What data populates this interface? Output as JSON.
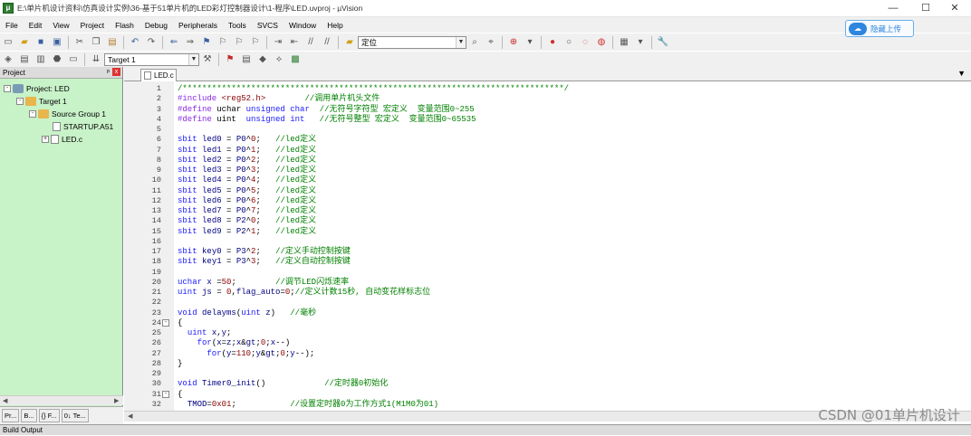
{
  "window": {
    "title": "E:\\单片机设计资料\\仿真设计实例\\36-基于51单片机的LED彩灯控制器设计\\1-程序\\LED.uvproj - µVision",
    "minimize": "—",
    "maximize": "☐",
    "close": "✕"
  },
  "menu": [
    "File",
    "Edit",
    "View",
    "Project",
    "Flash",
    "Debug",
    "Peripherals",
    "Tools",
    "SVCS",
    "Window",
    "Help"
  ],
  "toolbar1": {
    "find_value": "定位"
  },
  "toolbar2": {
    "target": "Target 1"
  },
  "upload_button": "隐藏上传",
  "project_panel": {
    "header": "Project",
    "pin": "ᵖ",
    "close": "x",
    "tree": [
      {
        "label": "Project: LED",
        "exp": "-"
      },
      {
        "label": "Target 1",
        "exp": "-"
      },
      {
        "label": "Source Group 1",
        "exp": "-"
      },
      {
        "label": "STARTUP.A51",
        "exp": ""
      },
      {
        "label": "LED.c",
        "exp": "+"
      }
    ],
    "tabs": [
      "Pr...",
      "B...",
      "{} F...",
      "0↓ Te..."
    ]
  },
  "editor": {
    "tab": "LED.c",
    "lines": [
      {
        "n": "1",
        "f": "",
        "t": "/******************************************************************************/"
      },
      {
        "n": "2",
        "f": "",
        "t": "#include <reg52.h>        //调用单片机头文件"
      },
      {
        "n": "3",
        "f": "",
        "t": "#define uchar unsigned char  //无符号字符型 宏定义  变量范围0~255"
      },
      {
        "n": "4",
        "f": "",
        "t": "#define uint  unsigned int   //无符号整型 宏定义  变量范围0~65535"
      },
      {
        "n": "5",
        "f": "",
        "t": ""
      },
      {
        "n": "6",
        "f": "",
        "t": "sbit led0 = P0^0;   //led定义"
      },
      {
        "n": "7",
        "f": "",
        "t": "sbit led1 = P0^1;   //led定义"
      },
      {
        "n": "8",
        "f": "",
        "t": "sbit led2 = P0^2;   //led定义"
      },
      {
        "n": "9",
        "f": "",
        "t": "sbit led3 = P0^3;   //led定义"
      },
      {
        "n": "10",
        "f": "",
        "t": "sbit led4 = P0^4;   //led定义"
      },
      {
        "n": "11",
        "f": "",
        "t": "sbit led5 = P0^5;   //led定义"
      },
      {
        "n": "12",
        "f": "",
        "t": "sbit led6 = P0^6;   //led定义"
      },
      {
        "n": "13",
        "f": "",
        "t": "sbit led7 = P0^7;   //led定义"
      },
      {
        "n": "14",
        "f": "",
        "t": "sbit led8 = P2^0;   //led定义"
      },
      {
        "n": "15",
        "f": "",
        "t": "sbit led9 = P2^1;   //led定义"
      },
      {
        "n": "16",
        "f": "",
        "t": ""
      },
      {
        "n": "17",
        "f": "",
        "t": "sbit key0 = P3^2;   //定义手动控制按键"
      },
      {
        "n": "18",
        "f": "",
        "t": "sbit key1 = P3^3;   //定义自动控制按键"
      },
      {
        "n": "19",
        "f": "",
        "t": ""
      },
      {
        "n": "20",
        "f": "",
        "t": "uchar x =50;        //调节LED闪烁速率"
      },
      {
        "n": "21",
        "f": "",
        "t": "uint js = 0,flag_auto=0;//定义计数15秒, 自动变花样标志位"
      },
      {
        "n": "22",
        "f": "",
        "t": ""
      },
      {
        "n": "23",
        "f": "",
        "t": "void delayms(uint z)   //毫秒"
      },
      {
        "n": "24",
        "f": "-",
        "t": "{"
      },
      {
        "n": "25",
        "f": "",
        "t": "  uint x,y;"
      },
      {
        "n": "26",
        "f": "",
        "t": "    for(x=z;x>0;x--)"
      },
      {
        "n": "27",
        "f": "",
        "t": "      for(y=110;y>0;y--);"
      },
      {
        "n": "28",
        "f": "",
        "t": "}"
      },
      {
        "n": "29",
        "f": "",
        "t": ""
      },
      {
        "n": "30",
        "f": "",
        "t": "void Timer0_init()            //定时器0初始化"
      },
      {
        "n": "31",
        "f": "-",
        "t": "{"
      },
      {
        "n": "32",
        "f": "",
        "t": "  TMOD=0x01;           //设置定时器0为工作方式1(M1M0为01)"
      }
    ]
  },
  "watermark": "CSDN @01单片机设计",
  "build_output": "Build Output",
  "colors": {
    "project_bg": "#c8f2c8",
    "keyword": "#1a1aff",
    "comment": "#008000"
  }
}
